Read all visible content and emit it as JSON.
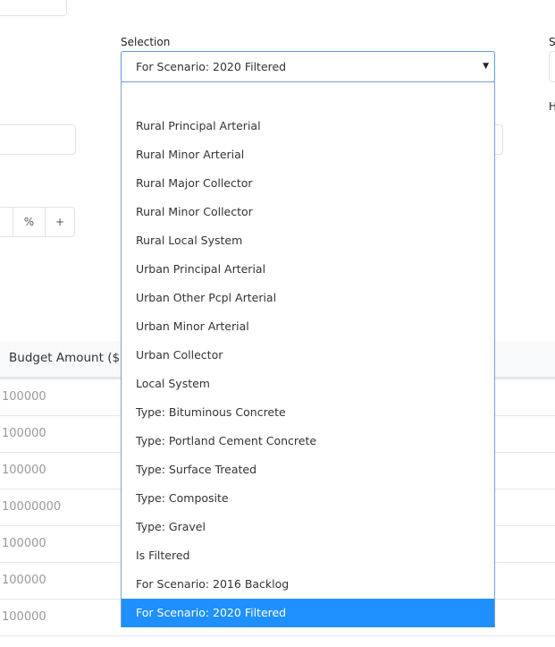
{
  "selection": {
    "label": "Selection",
    "value": "For Scenario: 2020 Filtered",
    "arrow_icon": "▼",
    "options": [
      "",
      "Rural Principal Arterial",
      "Rural Minor Arterial",
      "Rural Major Collector",
      "Rural Minor Collector",
      "Rural Local System",
      "Urban Principal Arterial",
      "Urban Other Pcpl Arterial",
      "Urban Minor Arterial",
      "Urban Collector",
      "Local System",
      "Type: Bituminous Concrete",
      "Type: Portland Cement Concrete",
      "Type: Surface Treated",
      "Type: Composite",
      "Type: Gravel",
      "Is Filtered",
      "For Scenario: 2016 Backlog",
      "For Scenario: 2020 Filtered"
    ],
    "selected_index": 18
  },
  "right_label_1": "S",
  "right_label_2": "H",
  "buttons": {
    "percent": "%",
    "plus": "+"
  },
  "table": {
    "header": "Budget Amount ($$",
    "rows": [
      "100000",
      "100000",
      "100000",
      "10000000",
      "100000",
      "100000",
      "100000"
    ]
  },
  "colors": {
    "accent": "#1e90ff",
    "focus_border": "#5b9bea"
  }
}
